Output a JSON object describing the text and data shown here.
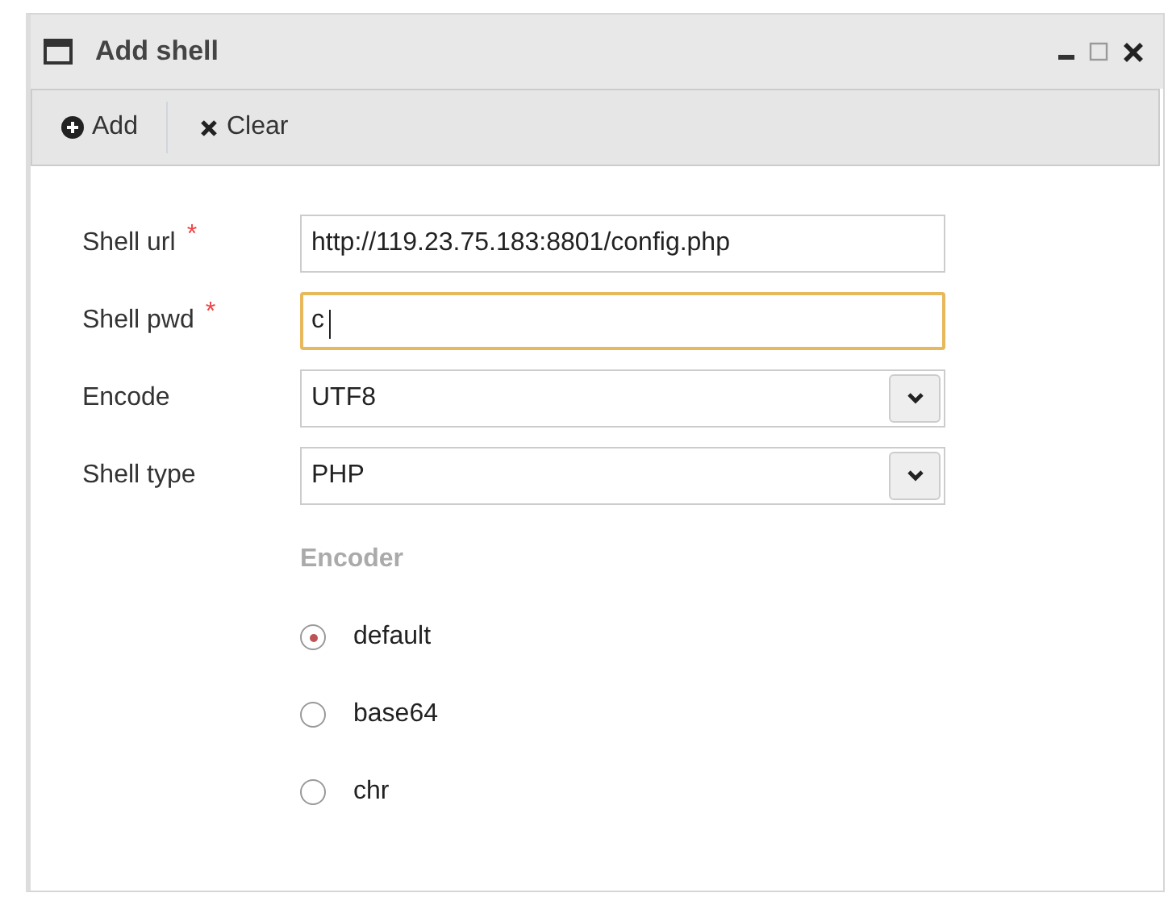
{
  "window": {
    "title": "Add shell"
  },
  "toolbar": [
    {
      "kind": "add",
      "label": "Add"
    },
    {
      "kind": "clear",
      "label": "Clear"
    }
  ],
  "fields": [
    {
      "kind": "text",
      "label": "Shell url",
      "required_mark": "*",
      "value": "http://119.23.75.183:8801/config.php",
      "focused": false
    },
    {
      "kind": "text",
      "label": "Shell pwd",
      "required_mark": "*",
      "value": "c",
      "focused": true
    },
    {
      "kind": "select",
      "label": "Encode",
      "value": "UTF8",
      "focused": false
    },
    {
      "kind": "select",
      "label": "Shell type",
      "value": "PHP",
      "focused": false
    }
  ],
  "encoder": {
    "title": "Encoder",
    "options": [
      {
        "label": "default",
        "selected": true
      },
      {
        "label": "base64",
        "selected": false
      },
      {
        "label": "chr",
        "selected": false
      }
    ]
  }
}
